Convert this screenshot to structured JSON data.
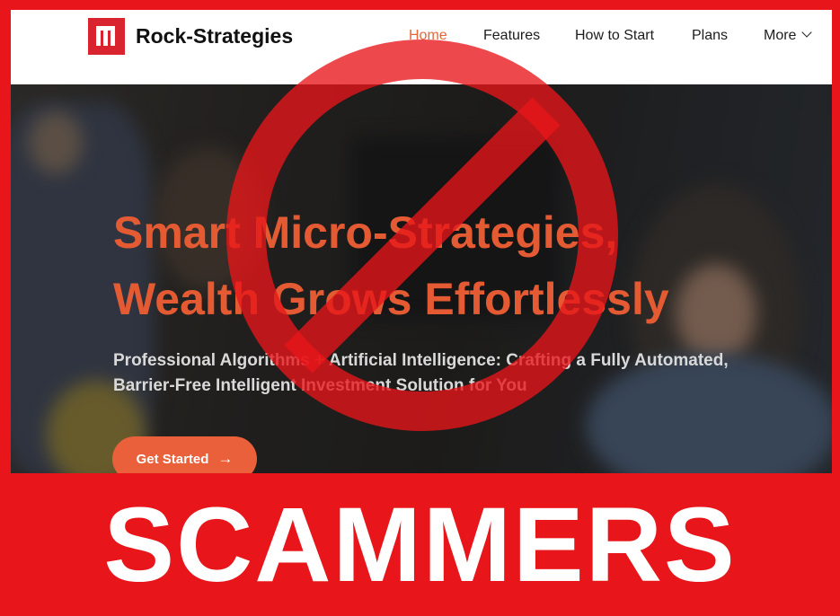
{
  "brand": {
    "name": "Rock-Strategies"
  },
  "nav": {
    "items": [
      {
        "label": "Home",
        "active": true
      },
      {
        "label": "Features"
      },
      {
        "label": "How to Start"
      },
      {
        "label": "Plans"
      },
      {
        "label": "More"
      }
    ]
  },
  "hero": {
    "title_line1": "Smart Micro-Strategies,",
    "title_line2": "Wealth Grows Effortlessly",
    "subtitle_line1": "Professional Algorithms + Artificial Intelligence: Crafting a Fully Automated,",
    "subtitle_line2": "Barrier-Free Intelligent Investment Solution for You",
    "cta_label": "Get Started"
  },
  "overlay": {
    "banner": "SCAMMERS",
    "sign": "prohibition-sign"
  },
  "colors": {
    "frame_red": "#e8161a",
    "brand_red": "#d9232f",
    "accent_orange": "#e9603a",
    "nav_active": "#e3673a"
  }
}
